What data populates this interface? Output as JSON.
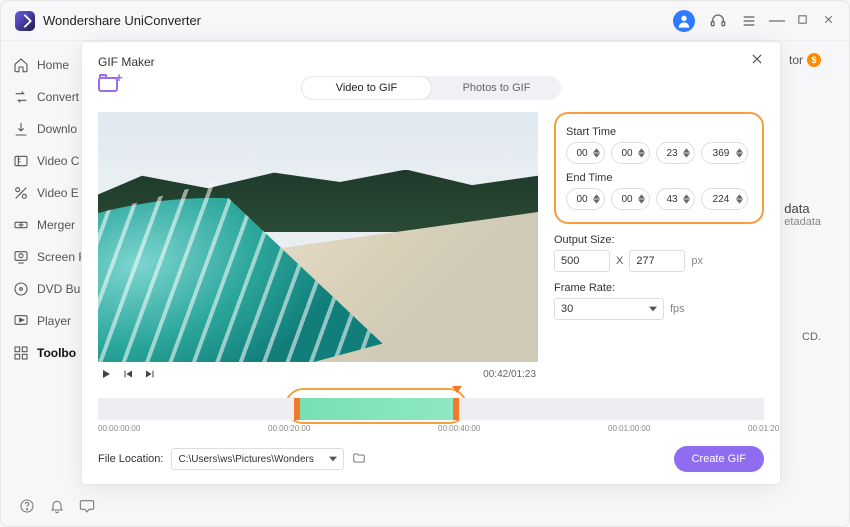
{
  "app": {
    "title": "Wondershare UniConverter"
  },
  "sidebar": {
    "items": [
      {
        "label": "Home"
      },
      {
        "label": "Convert"
      },
      {
        "label": "Downlo"
      },
      {
        "label": "Video C"
      },
      {
        "label": "Video E"
      },
      {
        "label": "Merger"
      },
      {
        "label": "Screen R"
      },
      {
        "label": "DVD Bu"
      },
      {
        "label": "Player"
      },
      {
        "label": "Toolbo"
      }
    ]
  },
  "background": {
    "tor": "tor",
    "data": "data",
    "data_sub": "etadata",
    "cd": "CD."
  },
  "modal": {
    "title": "GIF Maker",
    "tabs": {
      "video": "Video to GIF",
      "photos": "Photos to GIF"
    },
    "start_label": "Start Time",
    "end_label": "End Time",
    "start": {
      "h": "00",
      "m": "00",
      "s": "23",
      "ms": "369"
    },
    "end": {
      "h": "00",
      "m": "00",
      "s": "43",
      "ms": "224"
    },
    "output_label": "Output Size:",
    "out_w": "500",
    "out_by": "X",
    "out_h": "277",
    "out_unit": "px",
    "rate_label": "Frame Rate:",
    "rate_value": "30",
    "rate_unit": "fps",
    "play_time": "00:42/01:23",
    "ticks": {
      "t0": "00:00:00:00",
      "t1": "00:00:20:00",
      "t2": "00:00:40:00",
      "t3": "00:01:00:00",
      "t4": "00:01:20"
    },
    "loc_label": "File Location:",
    "loc_path": "C:\\Users\\ws\\Pictures\\Wonders",
    "create": "Create GIF"
  }
}
